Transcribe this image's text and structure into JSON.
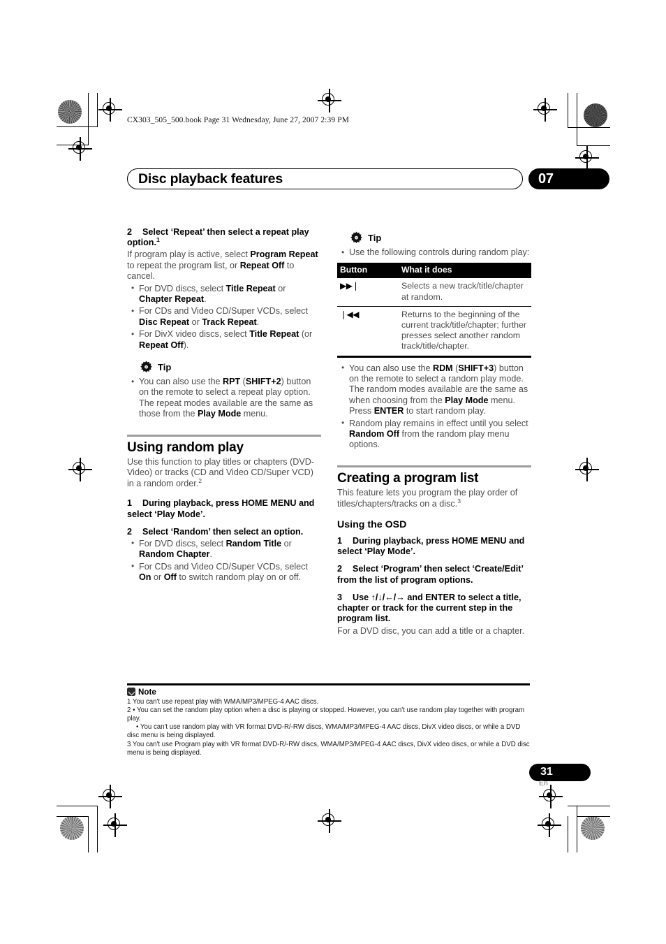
{
  "header": {
    "book_line": "CX303_505_500.book  Page 31  Wednesday, June 27, 2007  2:39 PM",
    "chapter_title": "Disc playback features",
    "chapter_number": "07"
  },
  "left_column": {
    "step2": {
      "num": "2",
      "text": "Select ‘Repeat’ then select a repeat play option.",
      "footnote_marker": "1"
    },
    "step2_body_1": "If program play is active, select ",
    "step2_body_b1": "Program Repeat",
    "step2_body_2": " to repeat the program list, or ",
    "step2_body_b2": "Repeat Off",
    "step2_body_3": " to cancel.",
    "bullets": [
      {
        "pre": "For DVD discs, select ",
        "b1": "Title Repeat",
        "mid": " or ",
        "b2": "Chapter Repeat",
        "post": "."
      },
      {
        "pre": "For CDs and Video CD/Super VCDs, select ",
        "b1": "Disc Repeat",
        "mid": " or ",
        "b2": "Track Repeat",
        "post": "."
      },
      {
        "pre": "For DivX video discs, select ",
        "b1": "Title Repeat",
        "mid": " (or ",
        "b2": "Repeat Off",
        "post": ")."
      }
    ],
    "tip": {
      "label": "Tip",
      "icon": "gear-icon",
      "bullet_pre": "You can also use the ",
      "bullet_b1": "RPT",
      "bullet_mid1": " (",
      "bullet_b2": "SHIFT",
      "bullet_plus": "+",
      "bullet_b3": "2",
      "bullet_mid2": ") button on the remote to select a repeat play option. The repeat modes available are the same as those from the ",
      "bullet_b4": "Play Mode",
      "bullet_post": " menu."
    },
    "section": {
      "heading": "Using random play",
      "intro_1": "Use this function to play titles or chapters (DVD-Video) or tracks (CD and Video CD/Super VCD) in a random order.",
      "intro_footnote": "2",
      "step1": {
        "num": "1",
        "text": "During playback, press HOME MENU and select ‘Play Mode’."
      },
      "step2": {
        "num": "2",
        "text": "Select ‘Random’ then select an option."
      },
      "step2_bullets": [
        {
          "pre": "For DVD discs, select ",
          "b1": "Random Title",
          "mid": " or ",
          "b2": "Random Chapter",
          "post": "."
        },
        {
          "pre": "For CDs and Video CD/Super VCDs, select ",
          "b1": "On",
          "mid": " or ",
          "b2": "Off",
          "post": " to switch random play on or off."
        }
      ]
    }
  },
  "right_column": {
    "tip": {
      "label": "Tip",
      "icon": "gear-icon",
      "bullet": "Use the following controls during random play:"
    },
    "table": {
      "headers": [
        "Button",
        "What it does"
      ],
      "rows": [
        {
          "button_icon": "skip-forward-icon",
          "button_glyph": "▶▶❘",
          "description": "Selects a new track/title/chapter at random."
        },
        {
          "button_icon": "skip-back-icon",
          "button_glyph": "❘◀◀",
          "description": "Returns to the beginning of the current track/title/chapter; further presses select another random track/title/chapter."
        }
      ]
    },
    "bullets": [
      {
        "pre": "You can also use the ",
        "b1": "RDM",
        "mid1": " (",
        "b2": "SHIFT",
        "plus": "+",
        "b3": "3",
        "mid2": ") button on the remote to select a random play mode. The random modes available are the same as when choosing from the ",
        "b4": "Play Mode",
        "mid3": " menu. Press ",
        "b5": "ENTER",
        "post": " to start random play."
      },
      {
        "pre": "Random play remains in effect until you select ",
        "b1": "Random Off",
        "post": " from the random play menu options."
      }
    ],
    "section": {
      "heading": "Creating a program list",
      "intro": "This feature lets you program the play order of titles/chapters/tracks on a disc.",
      "intro_footnote": "3",
      "subheading": "Using the OSD",
      "step1": {
        "num": "1",
        "text": "During playback, press HOME MENU and select ‘Play Mode’."
      },
      "step2": {
        "num": "2",
        "text": "Select ‘Program’ then select ‘Create/Edit’ from the list of program options."
      },
      "step3": {
        "num": "3",
        "text_pre": "Use ",
        "arrows": "↑/↓/←/→",
        "text_post": " and ENTER to select a title, chapter or track for the current step in the program list."
      },
      "step3_body": "For a DVD disc, you can add a title or a chapter."
    }
  },
  "notes": {
    "label": "Note",
    "icon": "note-icon",
    "items": [
      "1 You can't use repeat play with WMA/MP3/MPEG-4 AAC discs.",
      "2 • You can set the random play option when a disc is playing or stopped. However, you can't use random play together with program play.",
      "• You can't use random play with VR format DVD-R/-RW discs, WMA/MP3/MPEG-4 AAC discs, DivX video discs, or while a DVD disc menu is being displayed.",
      "3 You can't use Program play with VR format DVD-R/-RW discs, WMA/MP3/MPEG-4 AAC discs, DivX video discs, or while a DVD disc menu is being displayed."
    ]
  },
  "footer": {
    "page_number": "31",
    "language": "En"
  }
}
